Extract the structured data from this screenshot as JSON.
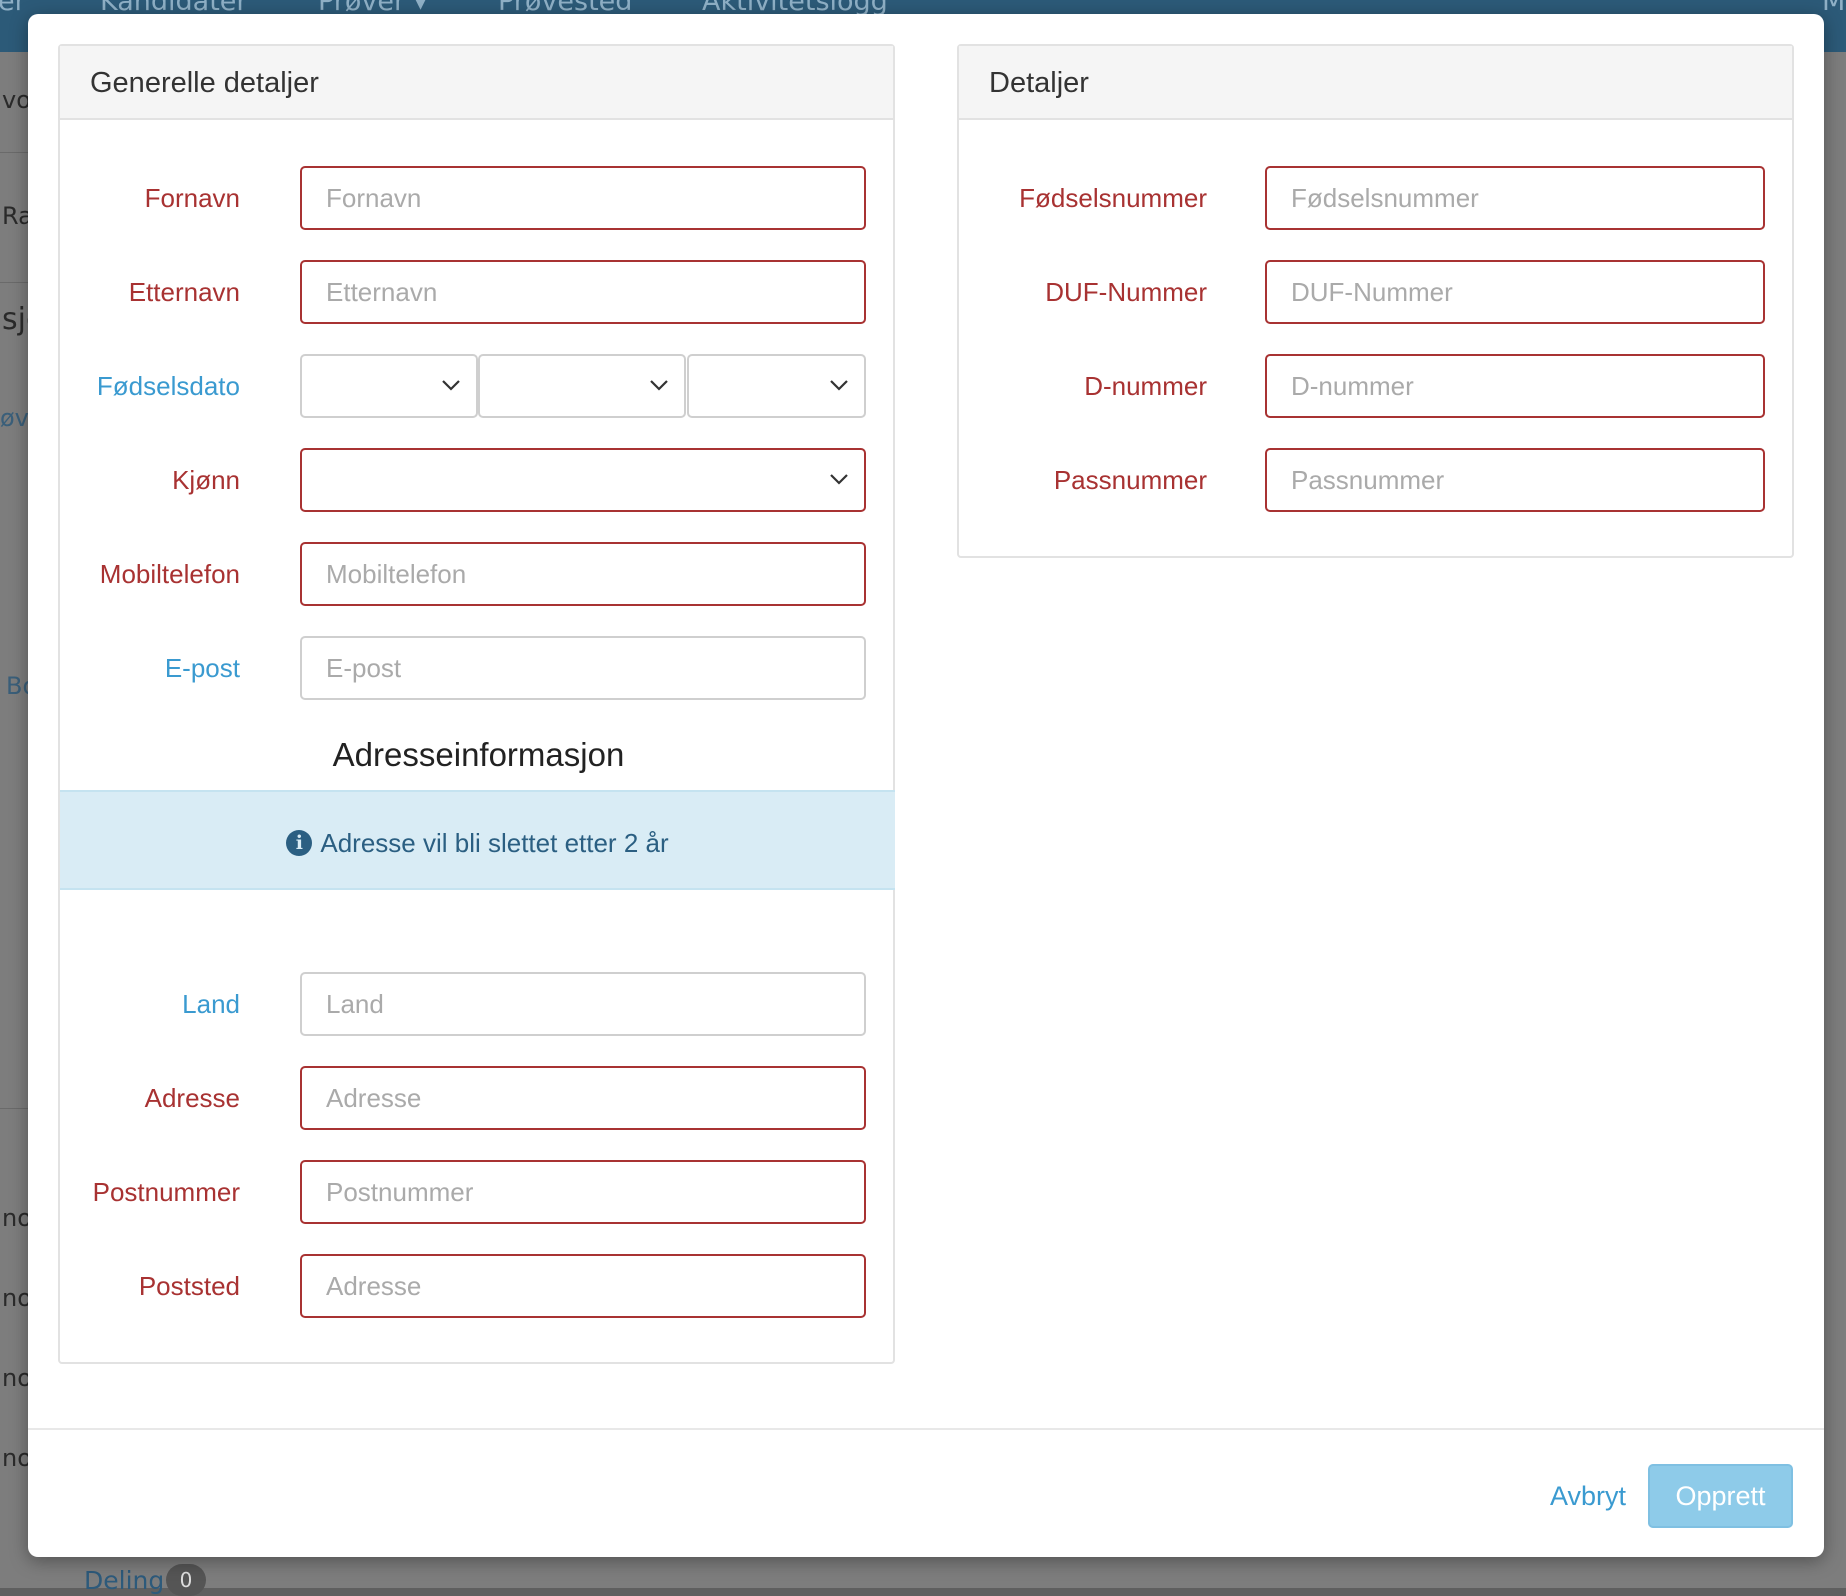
{
  "background": {
    "nav": [
      "Kandidater",
      "Prøver ▾",
      "Prøvested",
      "Aktivitetslogg"
    ],
    "nav_left": "er",
    "nav_right": "M",
    "row_fragments": [
      "vox",
      "Ra",
      "sjo",
      "øv",
      "Bo",
      "no",
      "no",
      "no",
      "no"
    ],
    "bottom_link": "Deling",
    "bottom_badge": "0"
  },
  "left_panel": {
    "title": "Generelle detaljer",
    "fields": {
      "fornavn": {
        "label": "Fornavn",
        "placeholder": "Fornavn"
      },
      "etternavn": {
        "label": "Etternavn",
        "placeholder": "Etternavn"
      },
      "fodselsdato": {
        "label": "Fødselsdato"
      },
      "kjonn": {
        "label": "Kjønn"
      },
      "mobiltelefon": {
        "label": "Mobiltelefon",
        "placeholder": "Mobiltelefon"
      },
      "epost": {
        "label": "E-post",
        "placeholder": "E-post"
      }
    },
    "address_title": "Adresseinformasjon",
    "address_notice": "Adresse vil bli slettet etter 2 år",
    "address_fields": {
      "land": {
        "label": "Land",
        "placeholder": "Land"
      },
      "adresse": {
        "label": "Adresse",
        "placeholder": "Adresse"
      },
      "postnummer": {
        "label": "Postnummer",
        "placeholder": "Postnummer"
      },
      "poststed": {
        "label": "Poststed",
        "placeholder": "Adresse"
      }
    }
  },
  "right_panel": {
    "title": "Detaljer",
    "fields": {
      "fodselsnummer": {
        "label": "Fødselsnummer",
        "placeholder": "Fødselsnummer"
      },
      "duf": {
        "label": "DUF-Nummer",
        "placeholder": "DUF-Nummer"
      },
      "dnummer": {
        "label": "D-nummer",
        "placeholder": "D-nummer"
      },
      "passnummer": {
        "label": "Passnummer",
        "placeholder": "Passnummer"
      }
    }
  },
  "footer": {
    "cancel": "Avbryt",
    "create": "Opprett"
  },
  "colors": {
    "required": "#a83232",
    "optional": "#3a9ad0",
    "primary_disabled": "#8ecbe9",
    "info_bg": "#d9ecf5"
  },
  "icons": [
    "chevron-down-icon",
    "info-circle-icon"
  ]
}
